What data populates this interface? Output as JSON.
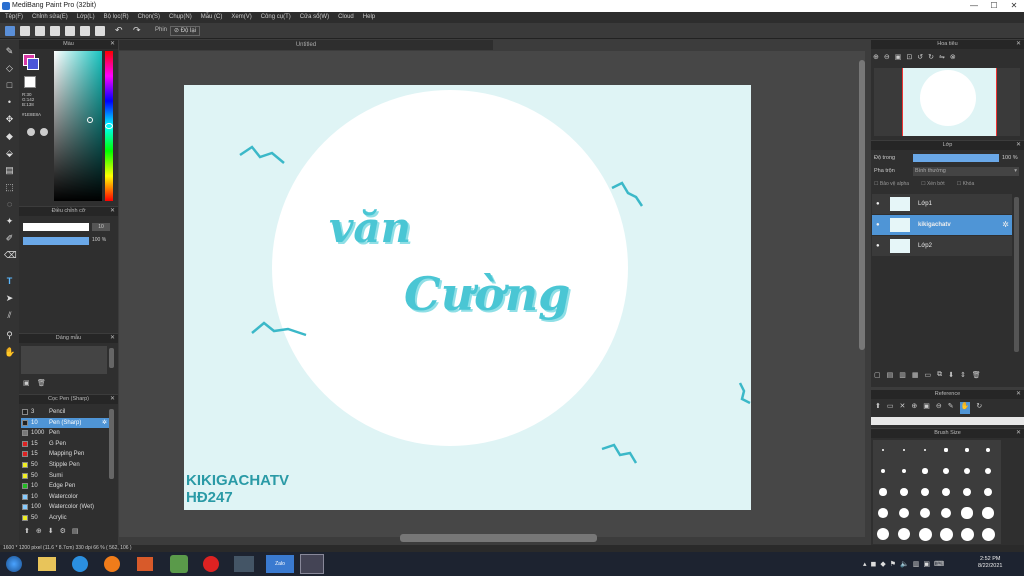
{
  "window": {
    "title": "MediBang Paint Pro (32bit)",
    "min": "—",
    "max": "☐",
    "close": "✕"
  },
  "menu": [
    "Tệp(F)",
    "Chỉnh sửa(E)",
    "Lớp(L)",
    "Bộ lọc(R)",
    "Chọn(S)",
    "Chụp(N)",
    "Mẫu (C)",
    "Xem(V)",
    "Công cụ(T)",
    "Cửa sổ(W)",
    "Cloud",
    "Help"
  ],
  "toolbar": {
    "label1": "Phin",
    "label2": "Độ lại"
  },
  "color_panel": {
    "title": "Màu",
    "hex": "#1E8E8A",
    "rgb": "R:30\nG:142\nB:138"
  },
  "brush_control": {
    "title": "Điều chỉnh cỡ",
    "size": "10",
    "opacity": "100 %"
  },
  "brush_panel": {
    "title": "Dáng mẫu"
  },
  "brush_list": {
    "title": "Cọc Pen (Sharp)",
    "items": [
      {
        "size": "3",
        "name": "Pencil",
        "color": "#222"
      },
      {
        "size": "10",
        "name": "Pen (Sharp)",
        "color": "#222",
        "selected": true
      },
      {
        "size": "1000",
        "name": "Pen",
        "color": "#777"
      },
      {
        "size": "15",
        "name": "G Pen",
        "color": "#d22"
      },
      {
        "size": "15",
        "name": "Mapping Pen",
        "color": "#d22"
      },
      {
        "size": "50",
        "name": "Stipple Pen",
        "color": "#ee2"
      },
      {
        "size": "50",
        "name": "Sumi",
        "color": "#ee2"
      },
      {
        "size": "10",
        "name": "Edge Pen",
        "color": "#2b2"
      },
      {
        "size": "10",
        "name": "Watercolor",
        "color": "#8cf"
      },
      {
        "size": "100",
        "name": "Watercolor (Wet)",
        "color": "#8cf"
      },
      {
        "size": "50",
        "name": "Acrylic",
        "color": "#ee2"
      }
    ]
  },
  "document": {
    "tab": "Untitled"
  },
  "artwork": {
    "line1": "văn",
    "line2": "Cường",
    "sign1": "KIKIGACHATV",
    "sign2": "HĐ247"
  },
  "navigator": {
    "title": "Hoa tiêu"
  },
  "layer_panel": {
    "title": "Lớp",
    "opacity_label": "Độ trong",
    "opacity_value": "100 %",
    "blend_label": "Pha trộn",
    "blend_value": "Bình thường",
    "check1": "Bảo vệ alpha",
    "check2": "Xén bớt",
    "check3": "Khóa",
    "layers": [
      {
        "name": "Lớp1",
        "selected": false
      },
      {
        "name": "kikigachatv",
        "selected": true
      },
      {
        "name": "Lớp2",
        "selected": false
      }
    ]
  },
  "reference": {
    "title": "Reference"
  },
  "brush_size": {
    "title": "Brush Size"
  },
  "status": {
    "text": "1600 * 1200 pixel  (11.6 * 8.7cm)  330 dpi  66 %  ( 562, 106 )"
  },
  "taskbar": {
    "time": "2:52 PM",
    "date": "8/22/2021"
  }
}
